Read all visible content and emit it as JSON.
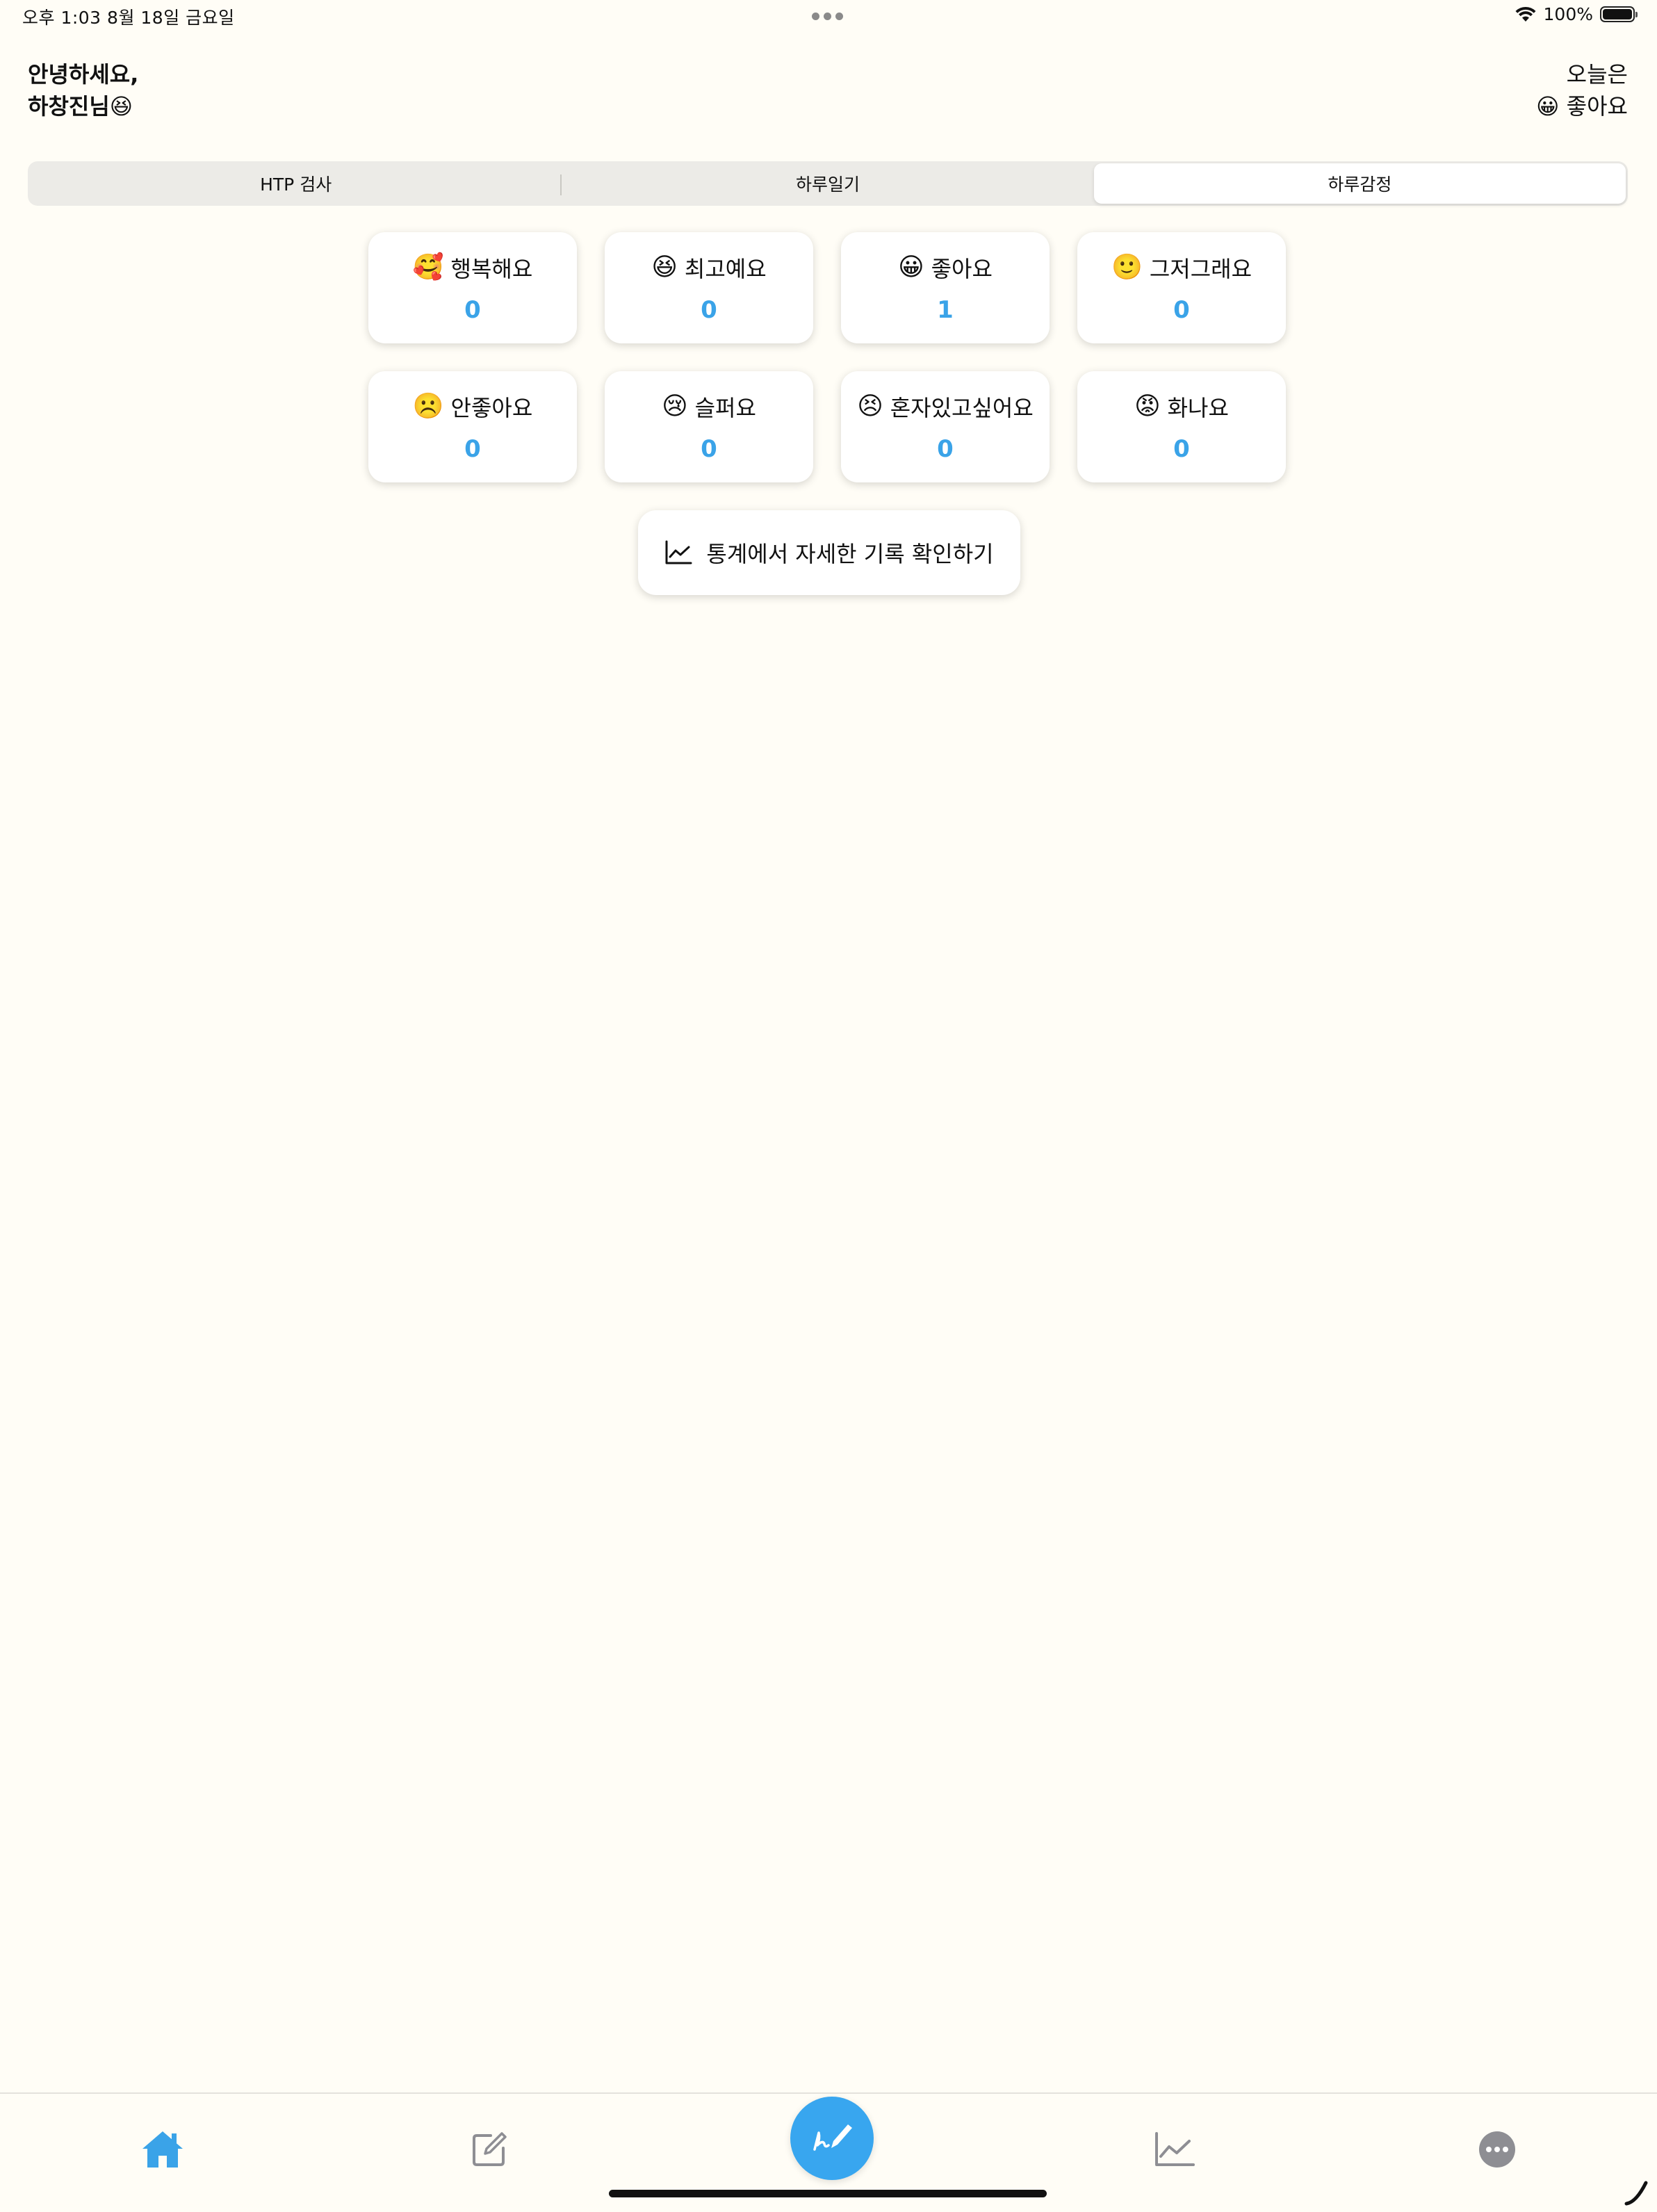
{
  "status_bar": {
    "time_date": "오후 1:03   8월 18일 금요일",
    "battery_percent": "100%",
    "battery_level": 1.0
  },
  "header": {
    "greeting_line1": "안녕하세요,",
    "greeting_line2": "하창진님",
    "greeting_emoji": "😆",
    "today_label": "오늘은",
    "today_emoji": "😀",
    "today_mood": "좋아요"
  },
  "segments": {
    "items": [
      {
        "label": "HTP 검사"
      },
      {
        "label": "하루일기"
      },
      {
        "label": "하루감정"
      }
    ],
    "selected": "하루감정"
  },
  "emotions": [
    {
      "emoji": "🥰",
      "label": "행복해요",
      "count": "0"
    },
    {
      "emoji": "😆",
      "label": "최고예요",
      "count": "0"
    },
    {
      "emoji": "😀",
      "label": "좋아요",
      "count": "1"
    },
    {
      "emoji": "🙂",
      "label": "그저그래요",
      "count": "0"
    },
    {
      "emoji": "☹️",
      "label": "안좋아요",
      "count": "0"
    },
    {
      "emoji": "😢",
      "label": "슬퍼요",
      "count": "0"
    },
    {
      "emoji": "😣",
      "label": "혼자있고싶어요",
      "count": "0"
    },
    {
      "emoji": "😡",
      "label": "화나요",
      "count": "0"
    }
  ],
  "stats_button": {
    "label": "통계에서 자세한 기록 확인하기",
    "icon": "chart-line-icon"
  },
  "tab_bar": {
    "items": [
      {
        "icon": "home-icon",
        "active": true
      },
      {
        "icon": "edit-icon",
        "active": false
      },
      {
        "icon": "pen-icon",
        "active": false
      },
      {
        "icon": "chart-line-icon",
        "active": false
      },
      {
        "icon": "more-icon",
        "active": false
      }
    ]
  },
  "colors": {
    "background": "#fffdf6",
    "accent": "#3aa3e8",
    "fab": "#38a6ef",
    "inactive_icon": "#8e8e93"
  }
}
